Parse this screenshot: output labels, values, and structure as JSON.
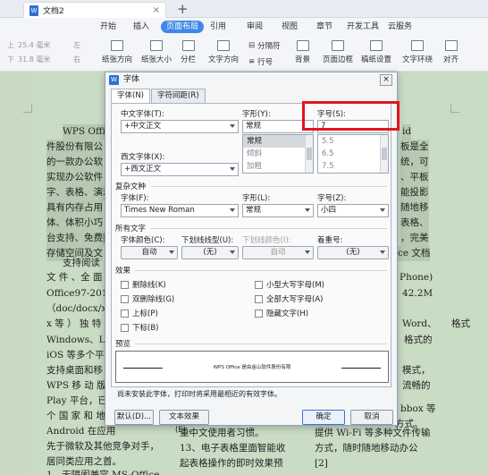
{
  "titlebar": {
    "doc_tab": "文档2",
    "close": "×",
    "new_tab": "+"
  },
  "menubar": {
    "items": [
      "开始",
      "插入",
      "页面布局",
      "引用",
      "审阅",
      "视图",
      "章节",
      "开发工具",
      "云服务"
    ],
    "active": "页面布局"
  },
  "ribbon": {
    "margin_top": "上",
    "margin_top_val": "25.4 毫米",
    "margin_bottom": "下",
    "margin_bottom_val": "31.8 毫米",
    "left_val": "左",
    "right_val": "右",
    "items": [
      "纸张方向",
      "纸张大小",
      "分栏",
      "文字方向",
      "行号",
      "背景",
      "页面边框",
      "稿纸设置",
      "文字环绕",
      "对齐"
    ],
    "split": "分隔符",
    "text_bg": "文字"
  },
  "document": {
    "lines_left": [
      "WPS Office",
      "件股份有限公",
      "的一款办公软",
      "实现办公软件",
      "字、表格、演示",
      "具有内存占用",
      "体、体积小巧",
      "台支持、免费提",
      "存储空间及文",
      "支持阅读",
      "文 件 、全 面",
      "Office97-2010",
      "（doc/docx/xl",
      "x 等 ） 独 特",
      "Windows、Linu",
      "iOS 等多个平台",
      "支持桌面和移",
      "WPS 移 动 版",
      "Play 平台，已",
      "个 国 家 和 地",
      "Android 在应用",
      "先于微软及其他竞争对手，",
      "居同类应用之首。",
      "1、无隔阂兼容 MS-Office"
    ],
    "lines_right": [
      "id",
      "板是全",
      "统，可",
      "、平板",
      "能投影",
      "随地移",
      "表格、",
      "，完美",
      "ce 文档",
      "Phone)",
      "42.2M",
      "格式",
      "Word、",
      "格式的",
      "模式，",
      "流畅的",
      "bbox 等",
      "方式。",
      "提供 Wi-Fi 等多种文件传输",
      "方式，随时随地移动办公",
      "[2]"
    ],
    "mid_lines": [
      "重中文使用者习惯。",
      "13、电子表格里面智能收",
      "起表格操作的即时效果预"
    ]
  },
  "dialog": {
    "title": "字体",
    "close": "×",
    "tabs": [
      "字体(N)",
      "字符间距(R)"
    ],
    "active_tab": "字体(N)",
    "cn_font_label": "中文字体(T):",
    "cn_font_value": "+中文正文",
    "style_label": "字形(Y):",
    "style_value": "常规",
    "style_options": [
      "常规",
      "倾斜",
      "加粗"
    ],
    "size_label": "字号(S):",
    "size_value": "7",
    "size_options": [
      "5.5",
      "6.5",
      "7.5"
    ],
    "west_font_label": "西文字体(X):",
    "west_font_value": "+西文正文",
    "complex_section": "复杂文种",
    "complex_font_label": "字体(F):",
    "complex_font_value": "Times New Roman",
    "complex_style_label": "字形(L):",
    "complex_style_value": "常规",
    "complex_size_label": "字号(Z):",
    "complex_size_value": "小四",
    "all_text_section": "所有文字",
    "color_label": "字体颜色(C):",
    "color_value": "自动",
    "underline_label": "下划线线型(U):",
    "underline_value": "(无)",
    "underline_color_label": "下划线颜色(I):",
    "underline_color_value": "自动",
    "emphasis_label": "着重号:",
    "emphasis_value": "(无)",
    "effects_section": "效果",
    "effects_left": [
      "删除线(K)",
      "双删除线(G)",
      "上标(P)",
      "下标(B)"
    ],
    "effects_right": [
      "小型大写字母(M)",
      "全部大写字母(A)",
      "隐藏文字(H)"
    ],
    "preview_section": "预览",
    "preview_text": "WPS Office 是由金山软件股份有限",
    "note": "尚未安装此字体，打印时将采用最相近的有效字体。",
    "btn_default": "默认(D)...",
    "btn_text_effect": "文本效果(E)...",
    "btn_ok": "确定",
    "btn_cancel": "取消"
  },
  "colors": {
    "accent": "#3f87e8",
    "highlight": "#e0161e",
    "page": "#c9dcc4"
  }
}
